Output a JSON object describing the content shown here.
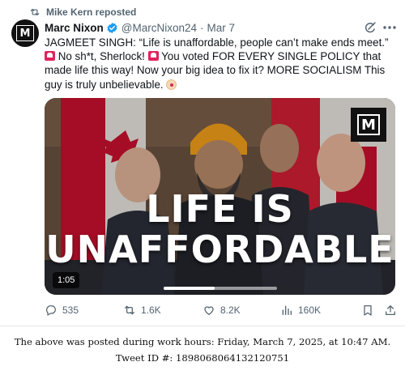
{
  "repost": {
    "label": "Mike Kern reposted",
    "icon": "repost-icon"
  },
  "author": {
    "name": "Marc Nixon",
    "handle": "@MarcNixon24",
    "separator": "·",
    "date": "Mar 7",
    "verified": true,
    "avatar_letter": "M"
  },
  "tweet": {
    "part1": "JAGMEET SINGH: “Life is unaffordable, people can’t make ends meet.” ",
    "part2": " No sh*t, Sherlock! ",
    "part3": " You voted FOR EVERY SINGLE POLICY that made life this way! Now your big idea to fix it? MORE SOCIALISM This guy is truly unbelievable. ",
    "emoji_siren": "police-car-light-emoji",
    "emoji_clown": "clown-face-emoji"
  },
  "media": {
    "overlay_line1": "LIFE IS",
    "overlay_line2": "UNAFFORDABLE",
    "badge_letter": "M",
    "duration": "1:05",
    "progress": 0.45
  },
  "actions": {
    "replies": "535",
    "reposts": "1.6K",
    "likes": "8.2K",
    "views": "160K"
  },
  "footer": {
    "line1": "The above was posted during work hours: Friday, March 7, 2025, at 10:47 AM.",
    "line2": "Tweet ID #: 1898068064132120751"
  },
  "colors": {
    "text_primary": "#0f1419",
    "text_secondary": "#536471",
    "verified_blue": "#1d9bf0"
  }
}
